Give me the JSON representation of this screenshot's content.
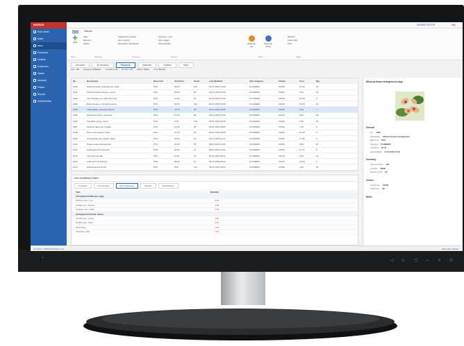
{
  "app": {
    "brand": "NAVISION",
    "user": "ADMINISTRATOR",
    "help": "Help"
  },
  "sidebar": {
    "items": [
      {
        "label": "Role Center"
      },
      {
        "label": "Sales"
      },
      {
        "label": "Items"
      },
      {
        "label": "Purchases"
      },
      {
        "label": "Vendors"
      },
      {
        "label": "Customers"
      },
      {
        "label": "Orders"
      },
      {
        "label": "Inventory"
      },
      {
        "label": "Posted"
      },
      {
        "label": "Reports"
      },
      {
        "label": "Administration"
      }
    ],
    "active_index": 2
  },
  "ribbon": {
    "tabs": [
      "Home",
      "Actions"
    ],
    "new_label": "New",
    "manage": [
      "View",
      "Edit List",
      "Delete"
    ],
    "process": [
      "Adjustment Journal",
      "Item Journal",
      "Requisition Worksheet"
    ],
    "report": [
      "Inventory - List",
      "Item Ledger",
      "Stock Details"
    ],
    "big_buttons": [
      "Show as List",
      "Show as Chart"
    ],
    "page": [
      "Refresh",
      "Clear Filter",
      "Find"
    ],
    "group_labels": [
      "New",
      "Manage",
      "Process",
      "Report",
      "View",
      "Page"
    ]
  },
  "doc_tabs": [
    "Overview",
    "All Inventory",
    "Products",
    "Attributes",
    "Variants",
    "Stock"
  ],
  "active_doc_tab": 2,
  "filters": [
    {
      "label": "Item",
      "value": "All"
    },
    {
      "label": "Category",
      "value": "Flowers"
    },
    {
      "label": "Location",
      "value": "All"
    },
    {
      "label": "Vendor",
      "value": "All"
    },
    {
      "label": "Status",
      "value": "Open"
    },
    {
      "label": "Unit",
      "value": "Pieces"
    }
  ],
  "grid": {
    "columns": [
      "No.",
      "Description",
      "Base Unit",
      "Unit Price",
      "Stock",
      "Last Modified",
      "Item Category",
      "Vendor",
      "Cost",
      "Qty"
    ],
    "rows": [
      [
        "1000",
        "Hibiscus flower arrangement, large",
        "PCS",
        "25.00",
        "100",
        "01-07-2015 10:42",
        "FLOWERS",
        "V1000",
        "12.50",
        "15"
      ],
      [
        "1001",
        "Orchid tropical bouquet, mixed",
        "PCS",
        "18.50",
        "82",
        "01-07-2015 10:45",
        "FLOWERS",
        "V1000",
        "9.20",
        "12"
      ],
      [
        "1002",
        "Lily arrangement, white and pink",
        "PCS",
        "21.00",
        "64",
        "01-07-2015 11:02",
        "FLOWERS",
        "V1020",
        "10.40",
        "9"
      ],
      [
        "1003",
        "Rose bouquet, red twelve stems",
        "PCS",
        "30.00",
        "120",
        "02-07-2015 09:15",
        "FLOWERS",
        "V1020",
        "15.00",
        "22"
      ],
      [
        "1004",
        "Tulip basket, assorted colours",
        "PCS",
        "16.75",
        "45",
        "02-07-2015 09:40",
        "FLOWERS",
        "V1030",
        "8.10",
        "7"
      ],
      [
        "1005",
        "Sunflower bunch, seasonal",
        "PCS",
        "12.00",
        "90",
        "02-07-2015 10:05",
        "FLOWERS",
        "V1030",
        "6.00",
        "18"
      ],
      [
        "1006",
        "Carnation spray, mixed",
        "PCS",
        "9.50",
        "150",
        "03-07-2015 08:30",
        "FLOWERS",
        "V1040",
        "4.60",
        "30"
      ],
      [
        "1007",
        "Gerbera daisy pot, orange",
        "PCS",
        "14.25",
        "38",
        "03-07-2015 08:52",
        "FLOWERS",
        "V1040",
        "7.00",
        "6"
      ],
      [
        "1008",
        "Peony centrepiece, blush",
        "PCS",
        "27.00",
        "26",
        "03-07-2015 09:20",
        "FLOWERS",
        "V1050",
        "13.40",
        "4"
      ],
      [
        "1009",
        "Chrysanthemum wreath, white",
        "PCS",
        "35.00",
        "20",
        "04-07-2015 11:10",
        "FLOWERS",
        "V1050",
        "17.80",
        "3"
      ],
      [
        "1010",
        "Freesia vase arrangement",
        "PCS",
        "19.00",
        "55",
        "04-07-2015 11:34",
        "FLOWERS",
        "V1060",
        "9.50",
        "10"
      ],
      [
        "1011",
        "Hydrangea blue bouquet",
        "PCS",
        "23.50",
        "47",
        "04-07-2015 12:01",
        "FLOWERS",
        "V1060",
        "11.70",
        "8"
      ],
      [
        "1012",
        "Iris spring bundle",
        "PCS",
        "11.00",
        "73",
        "05-07-2015 08:12",
        "FLOWERS",
        "V1070",
        "5.40",
        "14"
      ],
      [
        "1013",
        "Anthurium tropical pot",
        "PCS",
        "26.00",
        "31",
        "05-07-2015 08:44",
        "FLOWERS",
        "V1070",
        "13.00",
        "5"
      ],
      [
        "1014",
        "Daffodil spring bunch",
        "PCS",
        "8.50",
        "110",
        "05-07-2015 09:02",
        "FLOWERS",
        "V1080",
        "4.10",
        "25"
      ]
    ],
    "selected_row": 4
  },
  "lower": {
    "title": "Item Availability Details",
    "tabs": [
      "Overview",
      "Components",
      "Bill of Materials",
      "Variants",
      "Substitutions"
    ],
    "active_tab": 2,
    "col_type": "Type",
    "col_qty": "Quantity",
    "rows": [
      {
        "group": true,
        "text": "Arrangement Hibiscus, large"
      },
      {
        "group": false,
        "text": "Hibiscus stem, red",
        "value": "6.00"
      },
      {
        "group": false,
        "text": "Foliage mix, tropical",
        "value": "2.00"
      },
      {
        "group": false,
        "text": "Ceramic vase, white",
        "value": "1.00"
      },
      {
        "group": true,
        "text": "Arrangement Orchid, mixed"
      },
      {
        "group": false,
        "text": "Orchid stem, purple",
        "value": "4.00"
      },
      {
        "group": false,
        "text": "Orchid stem, white",
        "value": "3.00"
      },
      {
        "group": false,
        "text": "Moss base",
        "value": "1.00"
      },
      {
        "group": false,
        "text": "Gift wrap, clear",
        "value": "1.00"
      }
    ]
  },
  "detail": {
    "title": "Hibiscus flower arrangement, large",
    "sections": [
      {
        "name": "General",
        "lines": [
          {
            "k": "No.",
            "v": "1000"
          },
          {
            "k": "Description",
            "v": "Hibiscus flower arrangement"
          },
          {
            "k": "Base Unit",
            "v": "PCS"
          },
          {
            "k": "Category",
            "v": "FLOWERS"
          },
          {
            "k": "Unit Price",
            "v": "25.00"
          },
          {
            "k": "Last Modified",
            "v": "01-07-2015 10:42"
          }
        ]
      },
      {
        "name": "Inventory",
        "lines": [
          {
            "k": "Stock on Hand",
            "v": "100"
          },
          {
            "k": "Location",
            "v": "MAIN"
          },
          {
            "k": "Reorder Point",
            "v": "20"
          }
        ]
      },
      {
        "name": "Vendor",
        "lines": [
          {
            "k": "Vendor No.",
            "v": "V1000"
          },
          {
            "k": "Lead Time",
            "v": "3D"
          }
        ]
      },
      {
        "name": "Notes",
        "lines": []
      }
    ]
  },
  "status": {
    "left": "Company: CRONUS Flowers Ltd.",
    "right": "Show Item Details"
  },
  "monitor": {
    "controls": [
      "◁",
      "▷",
      "▢",
      "−",
      "+",
      "⏻"
    ]
  },
  "colors": {
    "sidebar": "#2b64ae",
    "brand": "#c9332c",
    "accent": "#2b64ae"
  }
}
